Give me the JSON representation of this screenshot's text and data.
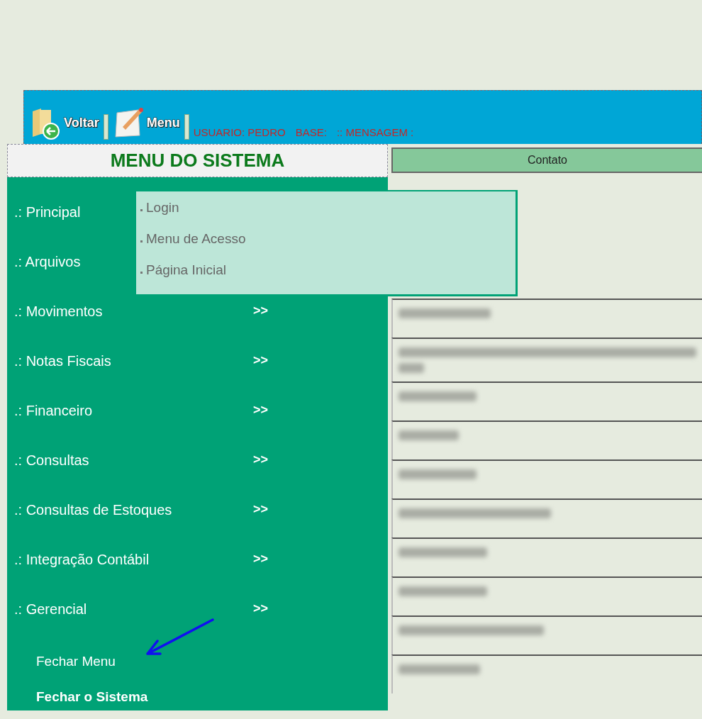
{
  "toolbar": {
    "buttons": [
      {
        "label": "Voltar"
      },
      {
        "label": "Menu"
      }
    ],
    "status": [
      "USUARIO: PEDRO",
      "BASE:",
      ":: MENSAGEM :"
    ]
  },
  "sidebar": {
    "title": "MENU DO SISTEMA",
    "items": [
      {
        "label": ".: Principal",
        "children": [
          {
            "label": "Login"
          },
          {
            "label": "Menu de Acesso"
          },
          {
            "label": "Página Inicial"
          }
        ]
      },
      {
        "label": ".: Arquivos"
      },
      {
        "label": ".: Movimentos",
        "arrow": ">>"
      },
      {
        "label": ".: Notas Fiscais",
        "arrow": ">>"
      },
      {
        "label": ".: Financeiro",
        "arrow": ">>"
      },
      {
        "label": ".: Consultas",
        "arrow": ">>"
      },
      {
        "label": ".: Consultas de Estoques",
        "arrow": ">>"
      },
      {
        "label": ".: Integração Contábil",
        "arrow": ">>"
      },
      {
        "label": ".: Gerencial",
        "arrow": ">>"
      }
    ],
    "footer": [
      {
        "label": "Fechar Menu",
        "kind": "normal"
      },
      {
        "label": "Fechar o Sistema",
        "kind": "bold"
      }
    ]
  },
  "table": {
    "columns": [
      "Contato"
    ],
    "rows": [
      {
        "kind": "blurred"
      },
      {
        "kind": "blurred-wrapped"
      },
      {
        "kind": "blurred"
      },
      {
        "kind": "blurred"
      },
      {
        "kind": "blurred"
      },
      {
        "kind": "blurred"
      },
      {
        "kind": "blurred"
      },
      {
        "kind": "blurred"
      },
      {
        "kind": "blurred"
      },
      {
        "kind": "blurred"
      }
    ]
  }
}
